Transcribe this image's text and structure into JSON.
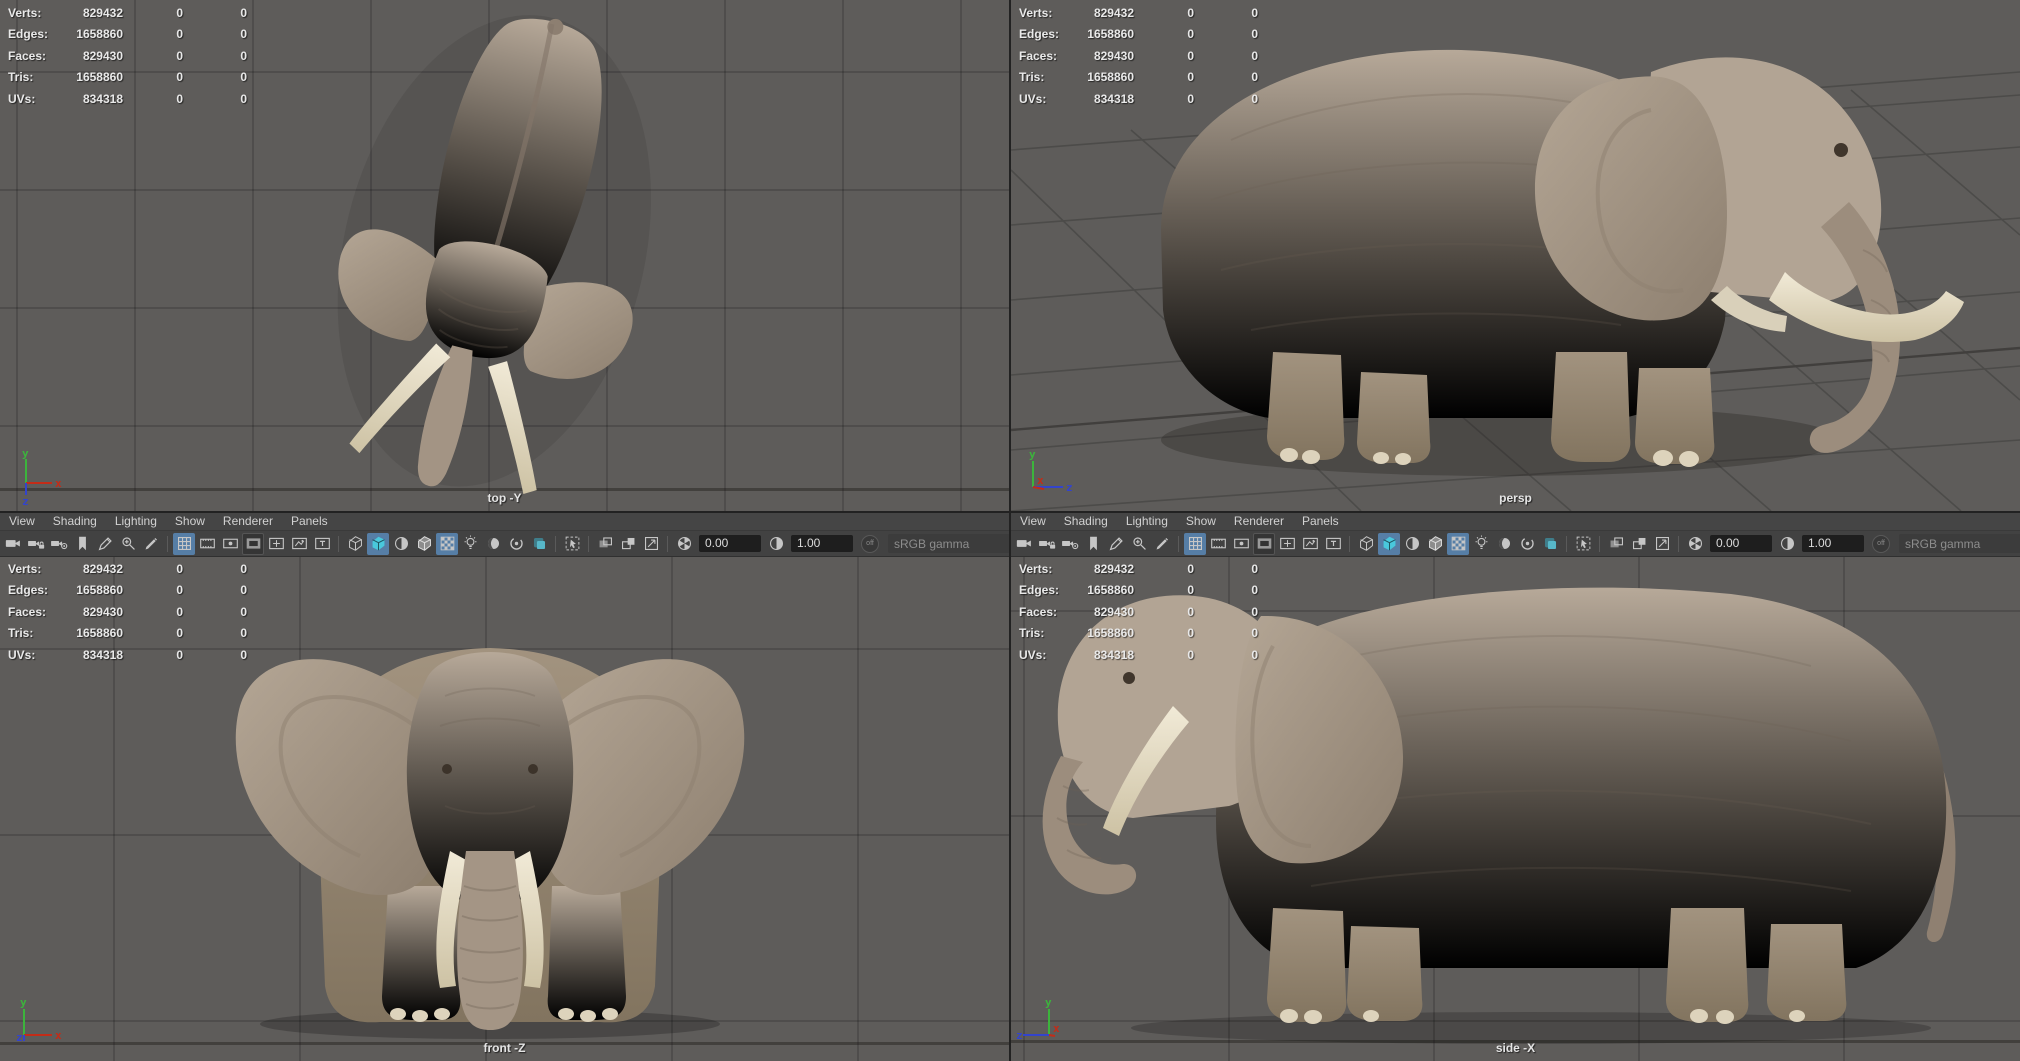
{
  "viewports": {
    "top_label": "top -Y",
    "persp_label": "persp",
    "front_label": "front -Z",
    "side_label": "side -X"
  },
  "hud": {
    "rows": [
      {
        "label": "Verts:",
        "total": "829432",
        "col2": "0",
        "col3": "0"
      },
      {
        "label": "Edges:",
        "total": "1658860",
        "col2": "0",
        "col3": "0"
      },
      {
        "label": "Faces:",
        "total": "829430",
        "col2": "0",
        "col3": "0"
      },
      {
        "label": "Tris:",
        "total": "1658860",
        "col2": "0",
        "col3": "0"
      },
      {
        "label": "UVs:",
        "total": "834318",
        "col2": "0",
        "col3": "0"
      }
    ]
  },
  "menus": {
    "items": [
      "View",
      "Shading",
      "Lighting",
      "Show",
      "Renderer",
      "Panels"
    ]
  },
  "toolbar": {
    "exposure_value": "0.00",
    "gamma_value": "1.00",
    "cm_badge": "off",
    "gamma_preset": "sRGB gamma",
    "chevron_down": "▼",
    "icons": [
      "camera",
      "camera-lock",
      "camera-attributes",
      "bookmark",
      "grease-pencil",
      "pan-zoom",
      "marker",
      "grid",
      "film-gate",
      "resolution-gate",
      "gate-mask",
      "field-chart",
      "safe-action",
      "safe-title",
      "wireframe",
      "smooth-shade-all",
      "flat-shade-all",
      "wireframe-on-shaded",
      "textured",
      "lights",
      "shadows",
      "use-default-material",
      "screen-space-ao",
      "motion-blur",
      "isolate-select",
      "x-ray",
      "x-ray-joints",
      "x-ray-active",
      "exposure",
      "contrast",
      "color-management",
      "gamma-preset"
    ]
  },
  "axis_gizmo": {
    "x": "x",
    "y": "y",
    "z": "z"
  },
  "colors": {
    "viewport_bg": "#5e5c5a",
    "grid_line": "#4c4b49",
    "chrome_bg": "#454545",
    "toolbar_bg": "#424242",
    "highlight_blue": "#567ea6",
    "teal_icon": "#49c8dc",
    "hud_text": "#e9e9e9",
    "elephant_skin": "#ab9d8d",
    "tusk": "#ece4cf",
    "axis_x_red": "#c32c18",
    "axis_y_green": "#3cb43c",
    "axis_z_blue": "#3344cc"
  }
}
